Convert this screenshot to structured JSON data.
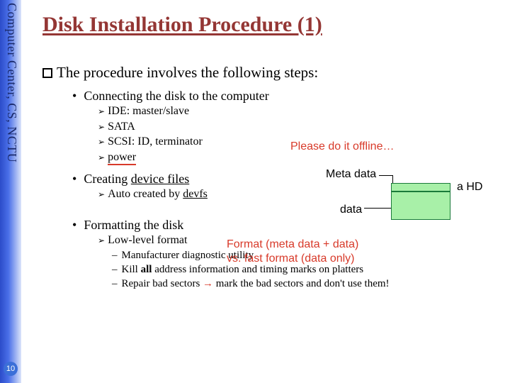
{
  "sidebar": {
    "org": "Computer Center, CS, NCTU"
  },
  "page": {
    "number": "10"
  },
  "title": "Disk Installation Procedure (1)",
  "intro": "The procedure involves the following steps:",
  "b1": {
    "text": "Connecting the disk to the computer",
    "s1": "IDE: master/slave",
    "s2": "SATA",
    "s3": "SCSI: ID, terminator",
    "s4": "power"
  },
  "offline": "Please do it offline…",
  "diagram": {
    "meta": "Meta data",
    "data": "data",
    "hd": "a HD"
  },
  "b2": {
    "text_a": "Creating ",
    "text_b": "device files",
    "s1_a": "Auto created by ",
    "s1_b": "devfs"
  },
  "b3": {
    "text": "Formatting the disk",
    "s1": "Low-level format",
    "d1": "Manufacturer diagnostic utility",
    "d2_a": "Kill ",
    "d2_b": "all",
    "d2_c": " address information and timing marks on platters",
    "d3_a": "Repair bad sectors ",
    "d3_arrow": "→",
    "d3_b": " mark the bad sectors and don't use them!"
  },
  "format_note": {
    "line1": "Format (meta data + data)",
    "line2": "vs. fast format (data only)"
  }
}
